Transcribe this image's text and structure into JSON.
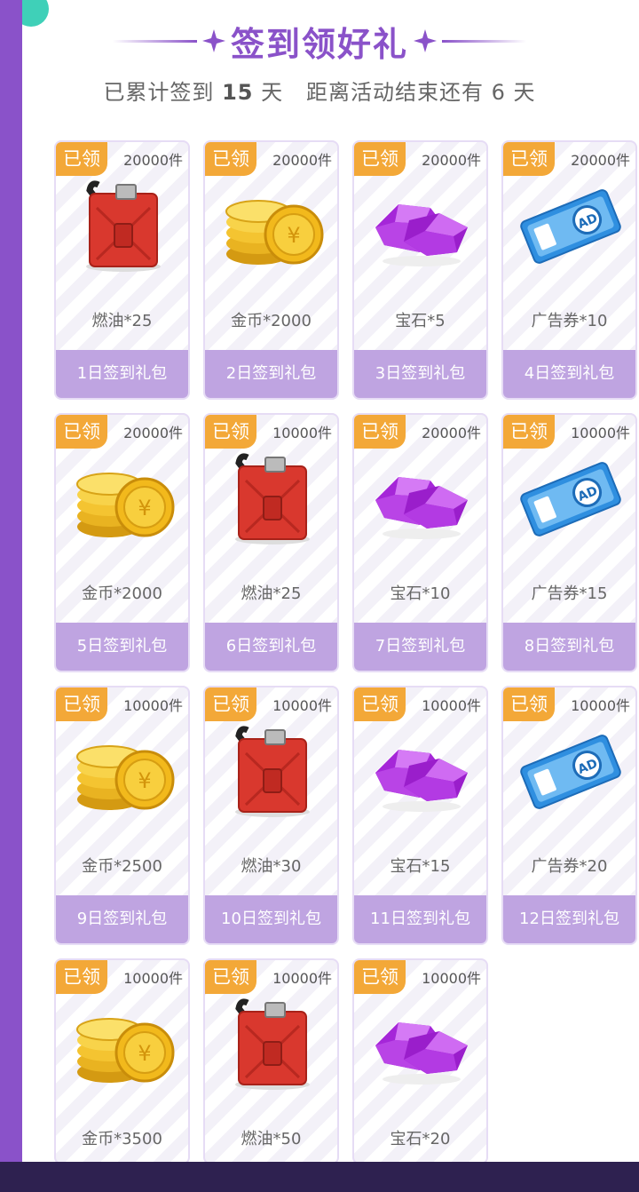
{
  "header": {
    "title": "签到领好礼",
    "subtitle_prefix": "已累计签到",
    "days_signed": "15",
    "subtitle_day_unit": "天",
    "subtitle_remaining": "距离活动结束还有 6 天"
  },
  "cards": [
    {
      "badge": "已领",
      "stock": "20000件",
      "icon": "fuel-can-icon",
      "name": "燃油*25",
      "gift": "1日签到礼包"
    },
    {
      "badge": "已领",
      "stock": "20000件",
      "icon": "gold-coins-icon",
      "name": "金币*2000",
      "gift": "2日签到礼包"
    },
    {
      "badge": "已领",
      "stock": "20000件",
      "icon": "gem-icon",
      "name": "宝石*5",
      "gift": "3日签到礼包"
    },
    {
      "badge": "已领",
      "stock": "20000件",
      "icon": "ad-ticket-icon",
      "name": "广告券*10",
      "gift": "4日签到礼包"
    },
    {
      "badge": "已领",
      "stock": "20000件",
      "icon": "gold-coins-icon",
      "name": "金币*2000",
      "gift": "5日签到礼包"
    },
    {
      "badge": "已领",
      "stock": "10000件",
      "icon": "fuel-can-icon",
      "name": "燃油*25",
      "gift": "6日签到礼包"
    },
    {
      "badge": "已领",
      "stock": "20000件",
      "icon": "gem-icon",
      "name": "宝石*10",
      "gift": "7日签到礼包"
    },
    {
      "badge": "已领",
      "stock": "10000件",
      "icon": "ad-ticket-icon",
      "name": "广告券*15",
      "gift": "8日签到礼包"
    },
    {
      "badge": "已领",
      "stock": "10000件",
      "icon": "gold-coins-icon",
      "name": "金币*2500",
      "gift": "9日签到礼包"
    },
    {
      "badge": "已领",
      "stock": "10000件",
      "icon": "fuel-can-icon",
      "name": "燃油*30",
      "gift": "10日签到礼包"
    },
    {
      "badge": "已领",
      "stock": "10000件",
      "icon": "gem-icon",
      "name": "宝石*15",
      "gift": "11日签到礼包"
    },
    {
      "badge": "已领",
      "stock": "10000件",
      "icon": "ad-ticket-icon",
      "name": "广告券*20",
      "gift": "12日签到礼包"
    },
    {
      "badge": "已领",
      "stock": "10000件",
      "icon": "gold-coins-icon",
      "name": "金币*3500",
      "gift": ""
    },
    {
      "badge": "已领",
      "stock": "10000件",
      "icon": "fuel-can-icon",
      "name": "燃油*50",
      "gift": ""
    },
    {
      "badge": "已领",
      "stock": "10000件",
      "icon": "gem-icon",
      "name": "宝石*20",
      "gift": ""
    }
  ],
  "colors": {
    "accent": "#8a52c9",
    "badge": "#f3a838",
    "gift_bar": "#bfa4e1",
    "bottom_bar": "#2e2150"
  }
}
